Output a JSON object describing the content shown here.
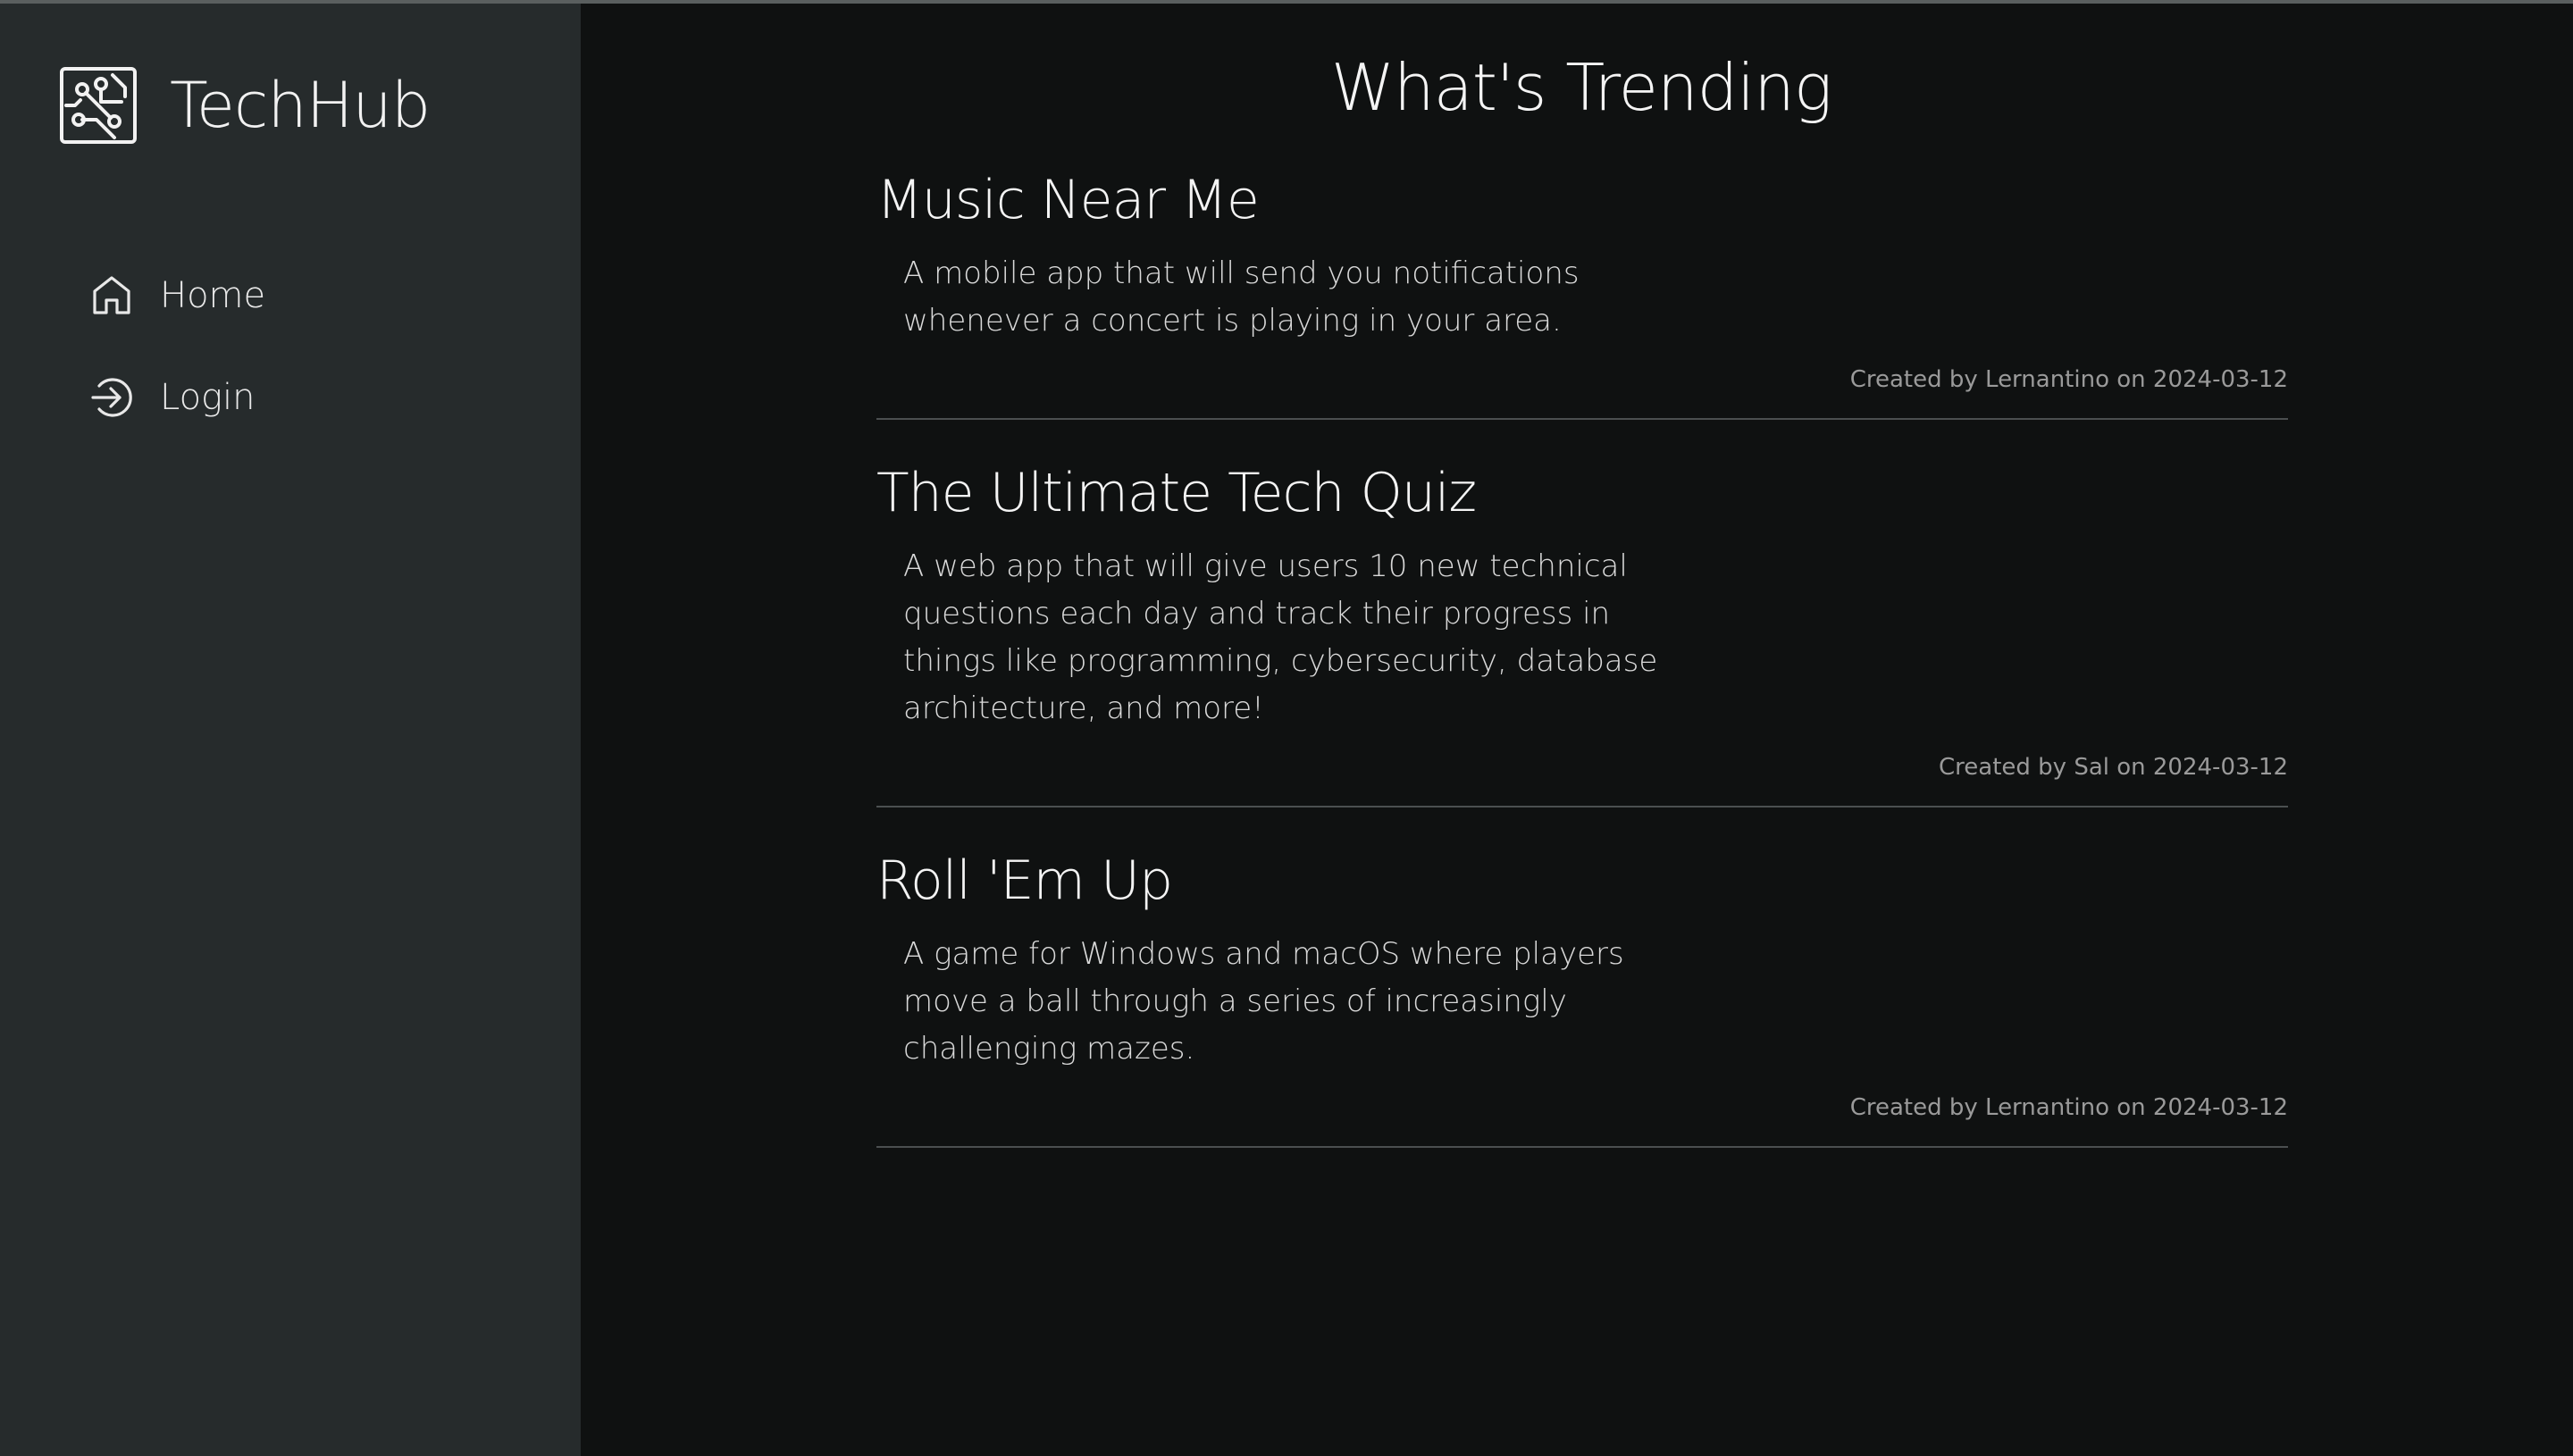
{
  "app": {
    "brand_name": "TechHub",
    "logo_icon": "circuit-board-icon"
  },
  "sidebar": {
    "items": [
      {
        "label": "Home",
        "icon": "home-icon"
      },
      {
        "label": "Login",
        "icon": "login-icon"
      }
    ]
  },
  "main": {
    "title": "What's Trending",
    "posts": [
      {
        "title": "Music Near Me",
        "description": "A mobile app that will send you notifications whenever a concert is playing in your area.",
        "meta": "Created by Lernantino on 2024-03-12"
      },
      {
        "title": "The Ultimate Tech Quiz",
        "description": "A web app that will give users 10 new technical questions each day and track their progress in things like programming, cybersecurity, database architecture, and more!",
        "meta": "Created by Sal on 2024-03-12"
      },
      {
        "title": "Roll 'Em Up",
        "description": "A game for Windows and macOS where players move a ball through a series of increasingly challenging mazes.",
        "meta": "Created by Lernantino on 2024-03-12"
      }
    ]
  },
  "colors": {
    "sidebar_bg": "#262b2c",
    "main_bg": "#0f1111",
    "divider": "#4b4f50",
    "text": "#f4f4f4",
    "meta_text": "#9a9a9a"
  }
}
